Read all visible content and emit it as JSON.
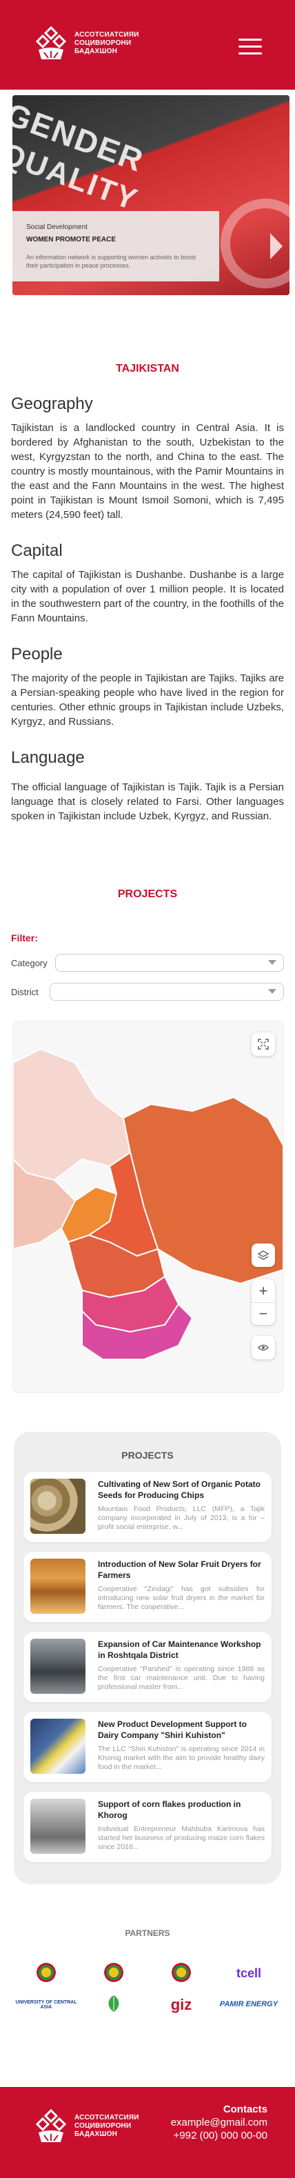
{
  "header": {
    "org_line1": "АССОТСИАТСИЯИ",
    "org_line2": "СОЦИВИОРОНИ",
    "org_line3": "БАДАХШОН"
  },
  "hero": {
    "word1": "GENDER",
    "word2": "QUALITY",
    "category": "Social Development",
    "title": "WOMEN PROMOTE PEACE",
    "description": "An information network is supporting women activists to boost their participation in peace processes."
  },
  "country": {
    "title": "TAJIKISTAN",
    "sections": [
      {
        "heading": "Geography",
        "text": "Tajikistan is a landlocked country in Central Asia. It is bordered by Afghanistan to the south, Uzbekistan to the west, Kyrgyzstan to the north, and China to the east. The country is mostly mountainous, with the Pamir Mountains in the east and the Fann Mountains in the west. The highest point in Tajikistan is Mount Ismoil Somoni, which is 7,495 meters (24,590 feet) tall."
      },
      {
        "heading": "Capital",
        "text": "The capital of Tajikistan is Dushanbe. Dushanbe is a large city with a population of over 1 million people. It is located in the southwestern part of the country, in the foothills of the Fann Mountains."
      },
      {
        "heading": "People",
        "text": "The majority of the people in Tajikistan are Tajiks. Tajiks are a Persian-speaking people who have lived in the region for centuries. Other ethnic groups in Tajikistan include Uzbeks, Kyrgyz, and Russians."
      },
      {
        "heading": "Language",
        "text": "The official language of Tajikistan is Tajik. Tajik is a Persian language that is closely related to Farsi. Other languages spoken in Tajikistan include Uzbek, Kyrgyz, and Russian."
      }
    ]
  },
  "projects_section": {
    "title": "PROJECTS",
    "filter_label": "Filter:",
    "category_label": "Category",
    "district_label": "District"
  },
  "map": {
    "region_colors": [
      "#f6d7cf",
      "#f2c2b4",
      "#e06a3a",
      "#f08a33",
      "#e85c3a",
      "#e06040",
      "#e14880",
      "#d94aa0"
    ]
  },
  "projects_list": {
    "title": "PROJECTS",
    "items": [
      {
        "title": "Cultivating of New Sort of Organic Potato Seeds for Producing Chips",
        "desc": "Mountain Food Products, LLC (MFP), a Tajik company incorporated in July of 2013, is a for – profit social enterprise, w..."
      },
      {
        "title": "Introduction of New Solar Fruit Dryers for Farmers",
        "desc": "Cooperative \"Zindagi\" has got subsidies for introducing new solar fruit dryers in the market for farmers. The cooperative..."
      },
      {
        "title": "Expansion of Car Maintenance Workshop in Roshtqala District",
        "desc": "Cooperative \"Parshed\" is operating since 1988 as the first car maintenance unit. Due to having professional master from..."
      },
      {
        "title": "New Product Development Support to Dairy Company \"Shiri Kuhiston\"",
        "desc": "The LLC \"Shiri Kuhiston\" is operating since 2014 in Khorog market with the aim to provide healthy dairy food in the market..."
      },
      {
        "title": "Support of corn flakes production in Khorog",
        "desc": "Individual Entrepreneur Mahbuba Karimova has started her business of producing maize corn flakes since 2016..."
      }
    ]
  },
  "partners": {
    "title": "PARTNERS",
    "items": [
      "tcell",
      "UNIVERSITY OF CENTRAL ASIA",
      "giz",
      "PAMIR ENERGY"
    ]
  },
  "footer": {
    "contacts_heading": "Contacts",
    "email": "example@gmail.com",
    "phone": "+992 (00) 000 00-00"
  }
}
